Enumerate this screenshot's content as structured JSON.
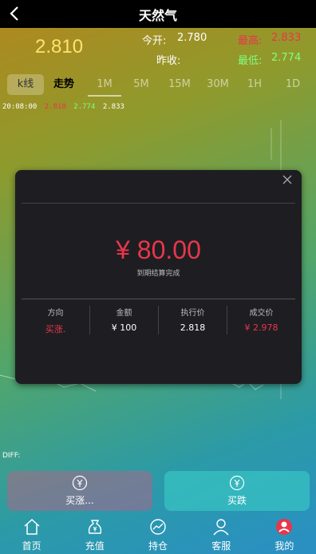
{
  "header": {
    "title": "天然气"
  },
  "quote": {
    "price": "2.810",
    "open_label": "今开:",
    "open_value": "2.780",
    "high_label": "最高:",
    "high_value": "2.833",
    "prev_close_label": "昨收:",
    "prev_close_value": "",
    "low_label": "最低:",
    "low_value": "2.774",
    "colors": {
      "price": "#ffe26e",
      "high": "#e8364b",
      "low": "#7fff7f"
    }
  },
  "tabs": [
    "k线",
    "走势",
    "1M",
    "5M",
    "15M",
    "30M",
    "1H",
    "1D"
  ],
  "chart_info": {
    "time": "20:08:00",
    "v1": "2.810",
    "v2": "2.774",
    "v3": "2.833"
  },
  "diff_label": "DIFF:",
  "result_modal": {
    "amount": "¥ 80.00",
    "subtitle": "到期结算完成",
    "columns": [
      {
        "header": "方向",
        "value": "买涨.",
        "color": "#e8364b"
      },
      {
        "header": "金额",
        "value": "¥ 100",
        "color": "#ffffff"
      },
      {
        "header": "执行价",
        "value": "2.818",
        "color": "#ffffff"
      },
      {
        "header": "成交价",
        "value": "¥ 2.978",
        "color": "#e8364b"
      }
    ]
  },
  "actions": {
    "rise_label": "买涨...",
    "fall_label": "买跌"
  },
  "nav": [
    {
      "label": "首页",
      "icon": "home-icon"
    },
    {
      "label": "充值",
      "icon": "money-bag-icon"
    },
    {
      "label": "持仓",
      "icon": "chart-icon"
    },
    {
      "label": "客服",
      "icon": "user-icon"
    },
    {
      "label": "我的",
      "icon": "profile-icon"
    }
  ]
}
